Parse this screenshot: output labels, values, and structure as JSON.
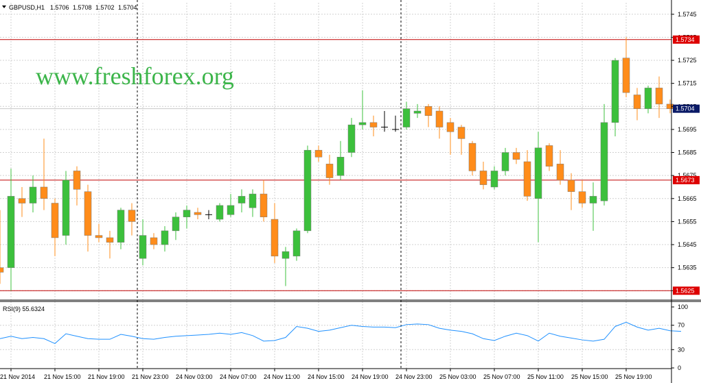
{
  "header": {
    "symbol": "GBPUSD,H1",
    "open": "1.5706",
    "high": "1.5708",
    "low": "1.5702",
    "close": "1.5704"
  },
  "watermark": "www.freshforex.org",
  "rsi_label": "RSI(9) 55.6324",
  "colors": {
    "bull": "#3cc03c",
    "bear": "#ff8c1a",
    "doji": "#000000",
    "level": "#c00000",
    "rsi": "#1e90ff",
    "current_badge": "#0a1a66",
    "level_badge": "#dd0000",
    "grid": "#d0d0d0"
  },
  "chart_data": {
    "type": "candlestick",
    "x_labels": [
      "21 Nov 2014",
      "21 Nov 15:00",
      "21 Nov 19:00",
      "21 Nov 23:00",
      "24 Nov 03:00",
      "24 Nov 07:00",
      "24 Nov 11:00",
      "24 Nov 15:00",
      "24 Nov 19:00",
      "24 Nov 23:00",
      "25 Nov 03:00",
      "25 Nov 07:00",
      "25 Nov 11:00",
      "25 Nov 15:00",
      "25 Nov 19:00"
    ],
    "price_ticks": [
      "1.5745",
      "1.5735",
      "1.5725",
      "1.5715",
      "1.5705",
      "1.5695",
      "1.5685",
      "1.5675",
      "1.5665",
      "1.5655",
      "1.5645",
      "1.5635",
      "1.5625"
    ],
    "price_range": [
      1.5623,
      1.575
    ],
    "rsi_ticks": [
      "100",
      "70",
      "30",
      "0"
    ],
    "rsi_range": [
      0,
      100
    ],
    "levels": [
      {
        "value": 1.5734,
        "label": "1.5734"
      },
      {
        "value": 1.5673,
        "label": "1.5673"
      },
      {
        "value": 1.5625,
        "label": "1.5625"
      }
    ],
    "current_price": {
      "value": 1.5704,
      "label": "1.5704"
    },
    "vertical_markers": [
      "21 Nov 23:00",
      "24 Nov 23:00"
    ],
    "candles": [
      {
        "o": 1.5635,
        "h": 1.566,
        "l": 1.5628,
        "c": 1.5633
      },
      {
        "o": 1.5635,
        "h": 1.5678,
        "l": 1.5625,
        "c": 1.5666
      },
      {
        "o": 1.5665,
        "h": 1.567,
        "l": 1.5657,
        "c": 1.5663
      },
      {
        "o": 1.5663,
        "h": 1.5675,
        "l": 1.5659,
        "c": 1.567
      },
      {
        "o": 1.567,
        "h": 1.5691,
        "l": 1.566,
        "c": 1.5665
      },
      {
        "o": 1.5663,
        "h": 1.5665,
        "l": 1.564,
        "c": 1.5648
      },
      {
        "o": 1.5649,
        "h": 1.5677,
        "l": 1.5645,
        "c": 1.5673
      },
      {
        "o": 1.5677,
        "h": 1.5679,
        "l": 1.5662,
        "c": 1.5669
      },
      {
        "o": 1.5668,
        "h": 1.5671,
        "l": 1.5642,
        "c": 1.5649
      },
      {
        "o": 1.5649,
        "h": 1.5654,
        "l": 1.5646,
        "c": 1.5648
      },
      {
        "o": 1.5648,
        "h": 1.5651,
        "l": 1.5639,
        "c": 1.5646
      },
      {
        "o": 1.5646,
        "h": 1.5661,
        "l": 1.5643,
        "c": 1.566
      },
      {
        "o": 1.566,
        "h": 1.5663,
        "l": 1.5649,
        "c": 1.5655
      },
      {
        "o": 1.5639,
        "h": 1.5656,
        "l": 1.5636,
        "c": 1.5649
      },
      {
        "o": 1.5648,
        "h": 1.565,
        "l": 1.5643,
        "c": 1.5645
      },
      {
        "o": 1.5645,
        "h": 1.5653,
        "l": 1.5642,
        "c": 1.5651
      },
      {
        "o": 1.5651,
        "h": 1.5659,
        "l": 1.5647,
        "c": 1.5657
      },
      {
        "o": 1.5657,
        "h": 1.5662,
        "l": 1.5652,
        "c": 1.566
      },
      {
        "o": 1.5659,
        "h": 1.5661,
        "l": 1.5656,
        "c": 1.5658
      },
      {
        "o": 1.5658,
        "h": 1.566,
        "l": 1.5656,
        "c": 1.5658
      },
      {
        "o": 1.5656,
        "h": 1.5663,
        "l": 1.5655,
        "c": 1.5662
      },
      {
        "o": 1.5658,
        "h": 1.5667,
        "l": 1.5657,
        "c": 1.5662
      },
      {
        "o": 1.5663,
        "h": 1.5669,
        "l": 1.5659,
        "c": 1.5666
      },
      {
        "o": 1.5661,
        "h": 1.5669,
        "l": 1.5657,
        "c": 1.5667
      },
      {
        "o": 1.5667,
        "h": 1.5673,
        "l": 1.5655,
        "c": 1.5657
      },
      {
        "o": 1.5656,
        "h": 1.5663,
        "l": 1.5637,
        "c": 1.564
      },
      {
        "o": 1.5639,
        "h": 1.5644,
        "l": 1.5627,
        "c": 1.5642
      },
      {
        "o": 1.564,
        "h": 1.5652,
        "l": 1.5638,
        "c": 1.5651
      },
      {
        "o": 1.5651,
        "h": 1.5688,
        "l": 1.565,
        "c": 1.5686
      },
      {
        "o": 1.5686,
        "h": 1.5688,
        "l": 1.5681,
        "c": 1.5683
      },
      {
        "o": 1.568,
        "h": 1.5684,
        "l": 1.5671,
        "c": 1.5674
      },
      {
        "o": 1.5675,
        "h": 1.569,
        "l": 1.5673,
        "c": 1.5683
      },
      {
        "o": 1.5685,
        "h": 1.57,
        "l": 1.5683,
        "c": 1.5697
      },
      {
        "o": 1.5697,
        "h": 1.5712,
        "l": 1.5695,
        "c": 1.5698
      },
      {
        "o": 1.5698,
        "h": 1.5701,
        "l": 1.5692,
        "c": 1.5696
      },
      {
        "o": 1.5696,
        "h": 1.5703,
        "l": 1.5694,
        "c": 1.5696
      },
      {
        "o": 1.5695,
        "h": 1.5701,
        "l": 1.5694,
        "c": 1.5695
      },
      {
        "o": 1.5696,
        "h": 1.5707,
        "l": 1.5695,
        "c": 1.5704
      },
      {
        "o": 1.5702,
        "h": 1.5706,
        "l": 1.57,
        "c": 1.5703
      },
      {
        "o": 1.5705,
        "h": 1.5706,
        "l": 1.5696,
        "c": 1.5701
      },
      {
        "o": 1.5703,
        "h": 1.5705,
        "l": 1.5691,
        "c": 1.5696
      },
      {
        "o": 1.5698,
        "h": 1.57,
        "l": 1.5684,
        "c": 1.5694
      },
      {
        "o": 1.5696,
        "h": 1.5697,
        "l": 1.5684,
        "c": 1.5691
      },
      {
        "o": 1.5689,
        "h": 1.569,
        "l": 1.5675,
        "c": 1.5677
      },
      {
        "o": 1.5677,
        "h": 1.5681,
        "l": 1.5669,
        "c": 1.5671
      },
      {
        "o": 1.567,
        "h": 1.5679,
        "l": 1.5669,
        "c": 1.5677
      },
      {
        "o": 1.5677,
        "h": 1.5687,
        "l": 1.5675,
        "c": 1.5685
      },
      {
        "o": 1.5685,
        "h": 1.5687,
        "l": 1.568,
        "c": 1.5682
      },
      {
        "o": 1.5681,
        "h": 1.5686,
        "l": 1.5664,
        "c": 1.5666
      },
      {
        "o": 1.5665,
        "h": 1.5694,
        "l": 1.5646,
        "c": 1.5687
      },
      {
        "o": 1.5688,
        "h": 1.5689,
        "l": 1.5677,
        "c": 1.5679
      },
      {
        "o": 1.568,
        "h": 1.5686,
        "l": 1.5671,
        "c": 1.5673
      },
      {
        "o": 1.5673,
        "h": 1.5676,
        "l": 1.566,
        "c": 1.5668
      },
      {
        "o": 1.5668,
        "h": 1.5673,
        "l": 1.5661,
        "c": 1.5663
      },
      {
        "o": 1.5663,
        "h": 1.5672,
        "l": 1.5651,
        "c": 1.5666
      },
      {
        "o": 1.5664,
        "h": 1.5706,
        "l": 1.5662,
        "c": 1.5698
      },
      {
        "o": 1.5698,
        "h": 1.5726,
        "l": 1.5692,
        "c": 1.5725
      },
      {
        "o": 1.5726,
        "h": 1.5735,
        "l": 1.5709,
        "c": 1.5711
      },
      {
        "o": 1.571,
        "h": 1.5713,
        "l": 1.5699,
        "c": 1.5704
      },
      {
        "o": 1.5704,
        "h": 1.5714,
        "l": 1.5702,
        "c": 1.5713
      },
      {
        "o": 1.5713,
        "h": 1.5718,
        "l": 1.57,
        "c": 1.5706
      },
      {
        "o": 1.5706,
        "h": 1.5708,
        "l": 1.5702,
        "c": 1.5704
      }
    ],
    "rsi": [
      48,
      52,
      48,
      50,
      48,
      40,
      56,
      52,
      48,
      47,
      47,
      55,
      52,
      48,
      47,
      50,
      52,
      53,
      54,
      55,
      57,
      55,
      58,
      53,
      44,
      45,
      50,
      68,
      65,
      60,
      62,
      66,
      70,
      68,
      67,
      67,
      66,
      71,
      72,
      71,
      65,
      62,
      60,
      56,
      48,
      45,
      52,
      57,
      53,
      44,
      57,
      52,
      49,
      46,
      44,
      47,
      68,
      75,
      67,
      62,
      65,
      61,
      60
    ]
  }
}
